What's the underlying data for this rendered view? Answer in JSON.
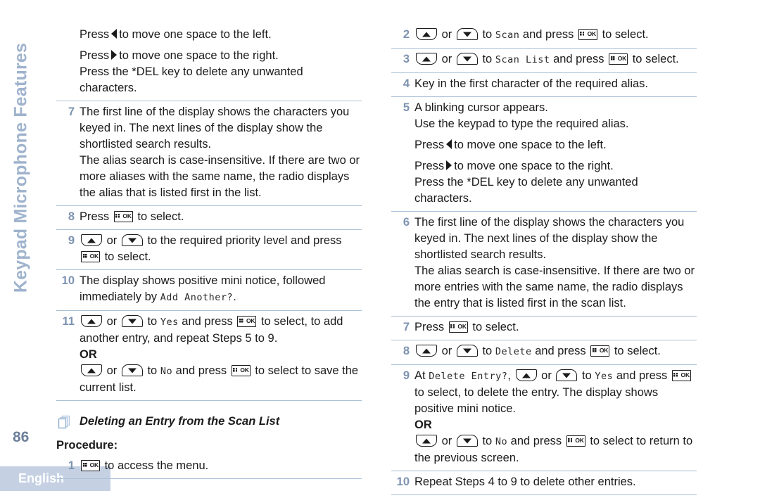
{
  "running_head": "Keypad Microphone Features",
  "page_number": "86",
  "language_bar": "English",
  "colors": {
    "accent_blue": "#7d93b0",
    "head_blue": "#9fb3cd",
    "rule_blue": "#a9c0d4",
    "lang_bar_bg": "#c5d1e3"
  },
  "icons": {
    "ok_key": "ok-key-icon",
    "up_key": "up-arrow-key-icon",
    "down_key": "down-arrow-key-icon",
    "left_nav": "left-triangle-icon",
    "right_nav": "right-triangle-icon",
    "pages": "stacked-pages-icon"
  },
  "ok_key_label": "OK",
  "left_column": {
    "intro_block": {
      "line1_a": "Press",
      "line1_b": "to move one space to the left.",
      "line2_a": "Press",
      "line2_b": "to move one space to the right.",
      "line3": "Press the *DEL key to delete any unwanted characters."
    },
    "step7": {
      "num": "7",
      "p1": "The first line of the display shows the characters you keyed in. The next lines of the display show the shortlisted search results.",
      "p2": "The alias search is case-insensitive. If there are two or more aliases with the same name, the radio displays the alias that is listed first in the list."
    },
    "step8": {
      "num": "8",
      "a": "Press",
      "b": "to select."
    },
    "step9": {
      "num": "9",
      "a": "or",
      "b": "to the required priority level and press",
      "c": "to select."
    },
    "step10": {
      "num": "10",
      "a": "The display shows positive mini notice, followed immediately by",
      "display": "Add Another?",
      "b": "."
    },
    "step11": {
      "num": "11",
      "a": "or",
      "b": "to",
      "display_yes": "Yes",
      "c": "and press",
      "d": "to select, to add another entry, and repeat Steps 5 to 9.",
      "or": "OR",
      "e": "or",
      "f": "to",
      "display_no": "No",
      "g": "and press",
      "h": "to select to save the current list."
    },
    "section": {
      "title": "Deleting an Entry from the Scan List",
      "procedure_label": "Procedure:"
    },
    "step1": {
      "num": "1",
      "a": "to access the menu."
    }
  },
  "right_column": {
    "step2": {
      "num": "2",
      "a": "or",
      "b": "to",
      "display": "Scan",
      "c": "and press",
      "d": "to select."
    },
    "step3": {
      "num": "3",
      "a": "or",
      "b": "to",
      "display": "Scan List",
      "c": "and press",
      "d": "to select."
    },
    "step4": {
      "num": "4",
      "a": "Key in the first character of the required alias."
    },
    "step5": {
      "num": "5",
      "p1": "A blinking cursor appears.",
      "p2": "Use the keypad to type the required alias.",
      "p3_a": "Press",
      "p3_b": "to move one space to the left.",
      "p4_a": "Press",
      "p4_b": "to move one space to the right.",
      "p5": "Press the *DEL key to delete any unwanted characters."
    },
    "step6": {
      "num": "6",
      "p1": "The first line of the display shows the characters you keyed in. The next lines of the display show the shortlisted search results.",
      "p2": "The alias search is case-insensitive. If there are two or more entries with the same name, the radio displays the entry that is listed first in the scan list."
    },
    "step7": {
      "num": "7",
      "a": "Press",
      "b": "to select."
    },
    "step8": {
      "num": "8",
      "a": "or",
      "b": "to",
      "display": "Delete",
      "c": "and press",
      "d": "to select."
    },
    "step9": {
      "num": "9",
      "a": "At",
      "display_entry": "Delete Entry?",
      "b": ",",
      "c": "or",
      "d": "to",
      "display_yes": "Yes",
      "e": "and press",
      "f": "to select, to delete the entry. The display shows positive mini notice.",
      "or": "OR",
      "g": "or",
      "h": "to",
      "display_no": "No",
      "i": "and press",
      "j": "to select to return to the previous screen."
    },
    "step10": {
      "num": "10",
      "a": "Repeat Steps 4 to 9 to delete other entries."
    }
  }
}
